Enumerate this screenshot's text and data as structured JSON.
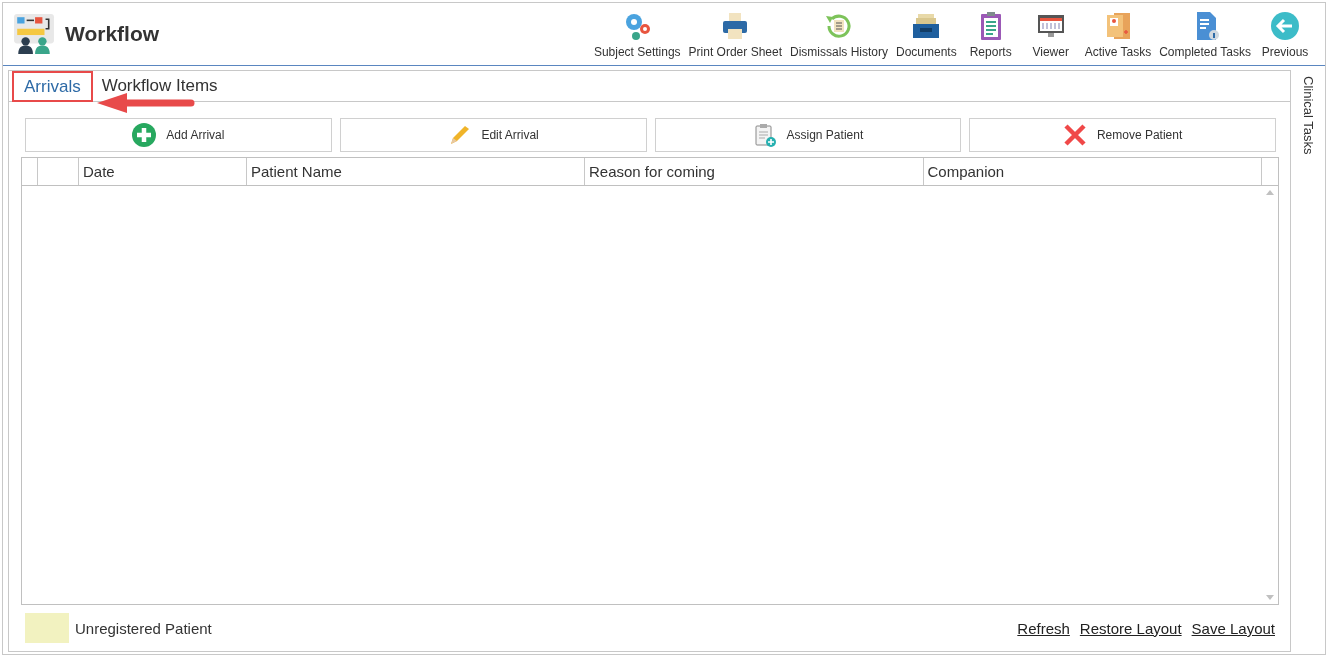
{
  "header": {
    "title": "Workflow"
  },
  "toolbar": [
    {
      "label": "Subject Settings",
      "kind": "gears"
    },
    {
      "label": "Print Order Sheet",
      "kind": "printer"
    },
    {
      "label": "Dismissals History",
      "kind": "history"
    },
    {
      "label": "Documents",
      "kind": "tray"
    },
    {
      "label": "Reports",
      "kind": "clipboard"
    },
    {
      "label": "Viewer",
      "kind": "monitor"
    },
    {
      "label": "Active Tasks",
      "kind": "folder"
    },
    {
      "label": "Completed Tasks",
      "kind": "document"
    },
    {
      "label": "Previous",
      "kind": "back"
    }
  ],
  "tabs": [
    {
      "label": "Arrivals",
      "selected": true,
      "highlighted": true,
      "arrow_pointing": true
    },
    {
      "label": "Workflow Items",
      "selected": false,
      "highlighted": false,
      "arrow_pointing": false
    }
  ],
  "actions": [
    {
      "label": "Add Arrival",
      "kind": "add"
    },
    {
      "label": "Edit Arrival",
      "kind": "edit"
    },
    {
      "label": "Assign Patient",
      "kind": "assign"
    },
    {
      "label": "Remove Patient",
      "kind": "remove"
    }
  ],
  "table": {
    "columns": [
      "Date",
      "Patient Name",
      "Reason for coming",
      "Companion"
    ]
  },
  "legend": [
    {
      "label": "Unregistered Patient",
      "color": "#f2f2c0"
    }
  ],
  "links": [
    "Refresh",
    "Restore Layout",
    "Save Layout"
  ],
  "side_panel": {
    "label": "Clinical Tasks"
  }
}
